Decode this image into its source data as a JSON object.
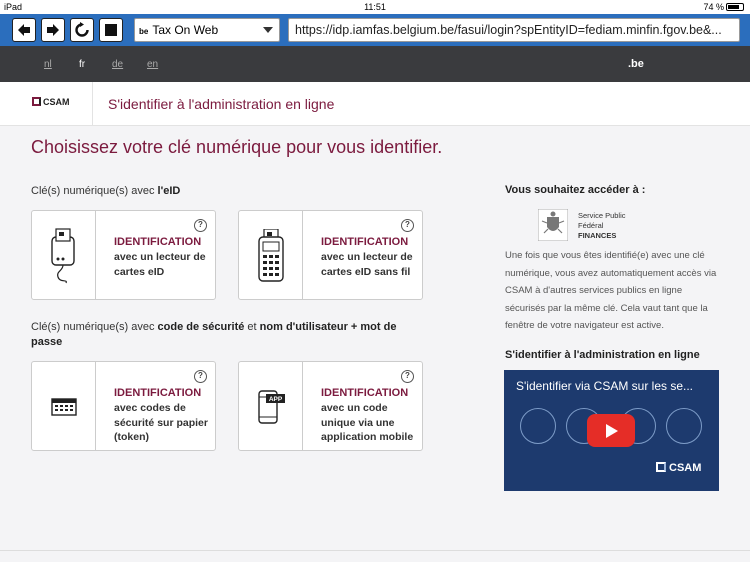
{
  "statusbar": {
    "device": "iPad",
    "time": "11:51",
    "battery": "74 %"
  },
  "browser": {
    "site_selector": {
      "prefix": "be",
      "label": "Tax On Web"
    },
    "url": "https://idp.iamfas.belgium.be/fasui/login?spEntityID=fediam.minfin.fgov.be&..."
  },
  "langbar": {
    "languages": [
      "nl",
      "fr",
      "de",
      "en"
    ],
    "active": "fr",
    "brand": ".be"
  },
  "header": {
    "logo": "CSAM",
    "title": "S'identifier à l'administration en ligne"
  },
  "main": {
    "title": "Choisissez votre clé numérique pour vous identifier.",
    "section1": {
      "text": "Clé(s) numérique(s) avec ",
      "bold": "l'eID"
    },
    "section2": {
      "text1": "Clé(s) numérique(s) avec ",
      "bold1": "code de sécurité",
      "text2": " et ",
      "bold2": "nom d'utilisateur + mot de passe"
    },
    "cards": [
      {
        "title": "IDENTIFICATION",
        "desc": "avec un lecteur de cartes eID",
        "help": "?"
      },
      {
        "title": "IDENTIFICATION",
        "desc": "avec un lecteur de cartes eID sans fil",
        "help": "?"
      },
      {
        "title": "IDENTIFICATION",
        "desc": "avec codes de sécurité sur papier (token)",
        "help": "?"
      },
      {
        "title": "IDENTIFICATION",
        "desc": "avec un code unique via une application mobile",
        "help": "?",
        "badge": "APP"
      }
    ]
  },
  "sidebar": {
    "heading": "Vous souhaitez accéder à :",
    "org": {
      "line1": "Service Public",
      "line2": "Fédéral",
      "line3": "FINANCES"
    },
    "text": "Une fois que vous êtes identifié(e) avec une clé numérique, vous avez automatiquement accès via CSAM à d'autres services publics en ligne sécurisés par la même clé. Cela vaut tant que la fenêtre de votre navigateur est active.",
    "video_heading": "S'identifier à l'administration en ligne",
    "video": {
      "title": "S'identifier via CSAM sur les se...",
      "logo": "CSAM"
    }
  }
}
